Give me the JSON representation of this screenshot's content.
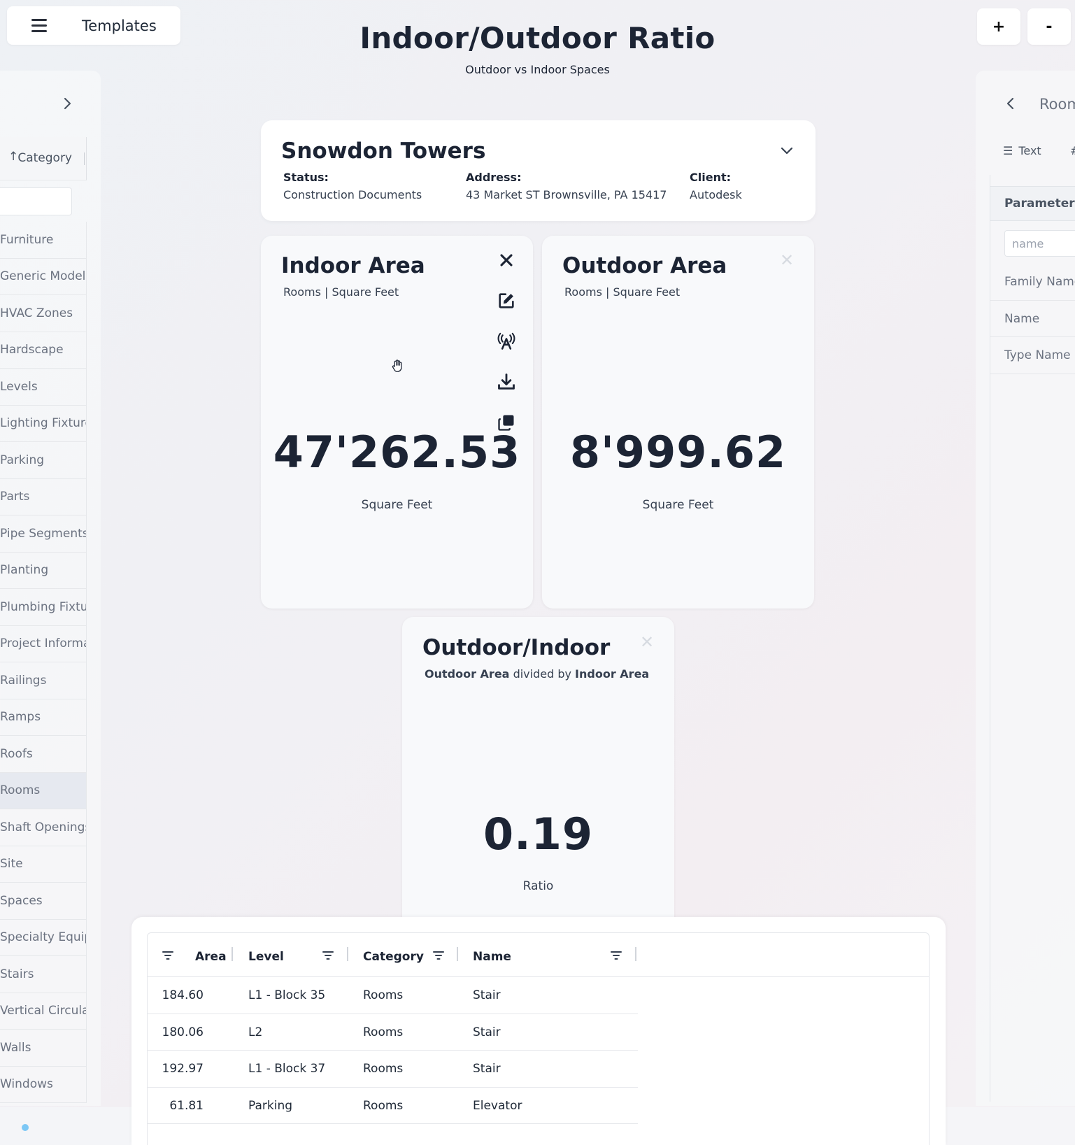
{
  "header": {
    "menu_label": "Templates",
    "title": "Indoor/Outdoor Ratio",
    "subtitle": "Outdoor vs Indoor Spaces",
    "zoom_in": "+",
    "zoom_out": "-"
  },
  "left_panel": {
    "column_header": "Category",
    "sort_arrow": "↑",
    "categories": [
      "Furniture",
      "Generic Models",
      "HVAC Zones",
      "Hardscape",
      "Levels",
      "Lighting Fixtures",
      "Parking",
      "Parts",
      "Pipe Segments",
      "Planting",
      "Plumbing Fixtures",
      "Project Information",
      "Railings",
      "Ramps",
      "Roofs",
      "Rooms",
      "Shaft Openings",
      "Site",
      "Spaces",
      "Specialty Equipment",
      "Stairs",
      "Vertical Circulation",
      "Walls",
      "Windows"
    ],
    "selected": "Rooms"
  },
  "right_panel": {
    "title": "Rooms",
    "tab_text": "Text",
    "tab_hash": "#",
    "parameter_header": "Parameter",
    "filter_placeholder": "name",
    "parameters": [
      "Family Name",
      "Name",
      "Type Name"
    ]
  },
  "project": {
    "name": "Snowdon Towers",
    "status_label": "Status:",
    "status_value": "Construction Documents",
    "address_label": "Address:",
    "address_value": "43 Market ST Brownsville, PA 15417",
    "client_label": "Client:",
    "client_value": "Autodesk"
  },
  "cards": {
    "indoor": {
      "title": "Indoor Area",
      "subtitle": "Rooms | Square Feet",
      "value": "47'262.53",
      "unit": "Square Feet"
    },
    "outdoor": {
      "title": "Outdoor Area",
      "subtitle": "Rooms | Square Feet",
      "value": "8'999.62",
      "unit": "Square Feet"
    },
    "ratio": {
      "title": "Outdoor/Indoor",
      "sub_a": "Outdoor Area",
      "sub_mid": "divided by",
      "sub_b": "Indoor Area",
      "value": "0.19",
      "unit": "Ratio"
    }
  },
  "table": {
    "columns": [
      "Area",
      "Level",
      "Category",
      "Name"
    ],
    "rows": [
      [
        "184.60",
        "L1 - Block 35",
        "Rooms",
        "Stair"
      ],
      [
        "180.06",
        "L2",
        "Rooms",
        "Stair"
      ],
      [
        "192.97",
        "L1 - Block 37",
        "Rooms",
        "Stair"
      ],
      [
        "61.81",
        "Parking",
        "Rooms",
        "Elevator"
      ]
    ]
  }
}
